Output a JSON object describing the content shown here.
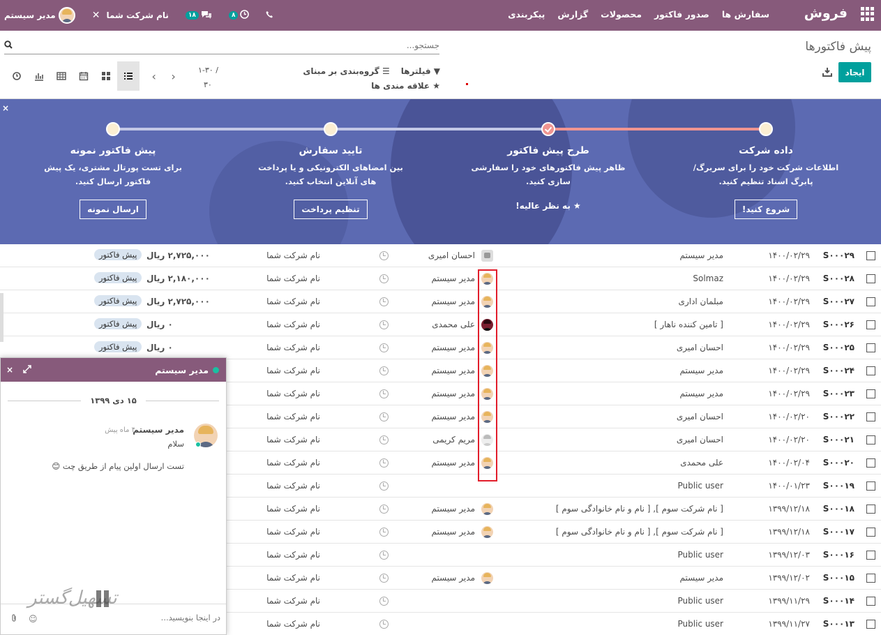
{
  "topbar": {
    "brand": "فروش",
    "menu": [
      "سفارش ها",
      "صدور فاکتور",
      "محصولات",
      "گزارش",
      "پیکربندی"
    ],
    "user_name": "مدیر سیستم",
    "company": "نام شرکت شما",
    "messages_count": "۱۸",
    "activities_count": "۸",
    "color": "#875a7b"
  },
  "control": {
    "breadcrumb": "پیش فاکتورها",
    "search_placeholder": "جستجو...",
    "create_label": "ایجاد",
    "filters_label": "فیلترها",
    "groupby_label": "گروه‌بندی بر مبنای",
    "favorites_label": "علاقه مندی ها",
    "pager_range": "۱-۳۰ /",
    "pager_total": "۳۰"
  },
  "banner": {
    "close": "×",
    "steps": [
      {
        "title": "داده شرکت",
        "desc1": "اطلاعات شرکت خود را برای سربرگ/",
        "desc2": "پابرگ اسناد تنظیم کنید.",
        "button": "شروع کنید!"
      },
      {
        "title": "طرح پیش فاکتور",
        "desc1": "ظاهر پیش فاکتورهای خود را سفارشی",
        "desc2": "سازی کنید.",
        "link": "به نظر عالیه!"
      },
      {
        "title": "تایید سفارش",
        "desc1": "بین امضاهای الکترونیکی و یا پرداخت",
        "desc2": "های آنلاین انتخاب کنید.",
        "button": "تنظیم پرداخت"
      },
      {
        "title": "پیش فاکتور نمونه",
        "desc1": "برای تست پورتال مشتری، یک پیش",
        "desc2": "فاکتور ارسال کنید.",
        "button": "ارسال نمونه"
      }
    ],
    "color": "#5c6ab2"
  },
  "rows": [
    {
      "name": "S۰۰۰۲۹",
      "date": "۱۴۰۰/۰۲/۲۹",
      "customer": "مدیر سیستم",
      "av": "cam",
      "sp": "احسان امیری",
      "company": "نام شرکت شما",
      "amount": "۲,۷۲۵,۰۰۰ ریال",
      "tag": "پیش فاکتور"
    },
    {
      "name": "S۰۰۰۲۸",
      "date": "۱۴۰۰/۰۲/۲۹",
      "customer": "Solmaz",
      "av": "man",
      "sp": "مدیر سیستم",
      "company": "نام شرکت شما",
      "amount": "۲,۱۸۰,۰۰۰ ریال",
      "tag": "پیش فاکتور"
    },
    {
      "name": "S۰۰۰۲۷",
      "date": "۱۴۰۰/۰۲/۲۹",
      "customer": "مبلمان اداری",
      "av": "man",
      "sp": "مدیر سیستم",
      "company": "نام شرکت شما",
      "amount": "۲,۷۲۵,۰۰۰ ریال",
      "tag": "پیش فاکتور"
    },
    {
      "name": "S۰۰۰۲۶",
      "date": "۱۴۰۰/۰۲/۲۹",
      "customer": "[ تامین کننده ناهار ]",
      "av": "dark",
      "sp": "علی محمدی",
      "company": "نام شرکت شما",
      "amount": "۰ ریال",
      "tag": "پیش فاکتور"
    },
    {
      "name": "S۰۰۰۲۵",
      "date": "۱۴۰۰/۰۲/۲۹",
      "customer": "احسان امیری",
      "av": "man",
      "sp": "مدیر سیستم",
      "company": "نام شرکت شما",
      "amount": "۰ ریال",
      "tag": "پیش فاکتور"
    },
    {
      "name": "S۰۰۰۲۴",
      "date": "۱۴۰۰/۰۲/۲۹",
      "customer": "مدیر سیستم",
      "av": "man",
      "sp": "مدیر سیستم",
      "company": "نام شرکت شما",
      "amount": "",
      "tag": ""
    },
    {
      "name": "S۰۰۰۲۳",
      "date": "۱۴۰۰/۰۲/۲۹",
      "customer": "مدیر سیستم",
      "av": "man",
      "sp": "مدیر سیستم",
      "company": "نام شرکت شما",
      "amount": "",
      "tag": ""
    },
    {
      "name": "S۰۰۰۲۲",
      "date": "۱۴۰۰/۰۲/۲۰",
      "customer": "احسان امیری",
      "av": "man",
      "sp": "مدیر سیستم",
      "company": "نام شرکت شما",
      "amount": "",
      "tag": ""
    },
    {
      "name": "S۰۰۰۲۱",
      "date": "۱۴۰۰/۰۲/۲۰",
      "customer": "احسان امیری",
      "av": "woman",
      "sp": "مریم کریمی",
      "company": "نام شرکت شما",
      "amount": "",
      "tag": ""
    },
    {
      "name": "S۰۰۰۲۰",
      "date": "۱۴۰۰/۰۲/۰۴",
      "customer": "علی محمدی",
      "av": "man",
      "sp": "مدیر سیستم",
      "company": "نام شرکت شما",
      "amount": "",
      "tag": ""
    },
    {
      "name": "S۰۰۰۱۹",
      "date": "۱۴۰۰/۰۱/۲۳",
      "customer": "Public user",
      "av": "",
      "sp": "",
      "company": "نام شرکت شما",
      "amount": "",
      "tag": ""
    },
    {
      "name": "S۰۰۰۱۸",
      "date": "۱۳۹۹/۱۲/۱۸",
      "customer": "[ نام شرکت سوم ], [ نام و نام خانوادگی سوم ]",
      "av": "man",
      "sp": "مدیر سیستم",
      "company": "نام شرکت شما",
      "amount": "",
      "tag": ""
    },
    {
      "name": "S۰۰۰۱۷",
      "date": "۱۳۹۹/۱۲/۱۸",
      "customer": "[ نام شرکت سوم ], [ نام و نام خانوادگی سوم ]",
      "av": "man",
      "sp": "مدیر سیستم",
      "company": "نام شرکت شما",
      "amount": "",
      "tag": ""
    },
    {
      "name": "S۰۰۰۱۶",
      "date": "۱۳۹۹/۱۲/۰۳",
      "customer": "Public user",
      "av": "",
      "sp": "",
      "company": "نام شرکت شما",
      "amount": "",
      "tag": ""
    },
    {
      "name": "S۰۰۰۱۵",
      "date": "۱۳۹۹/۱۲/۰۲",
      "customer": "مدیر سیستم",
      "av": "man",
      "sp": "مدیر سیستم",
      "company": "نام شرکت شما",
      "amount": "",
      "tag": ""
    },
    {
      "name": "S۰۰۰۱۴",
      "date": "۱۳۹۹/۱۱/۲۹",
      "customer": "Public user",
      "av": "",
      "sp": "",
      "company": "نام شرکت شما",
      "amount": "",
      "tag": ""
    },
    {
      "name": "S۰۰۰۱۳",
      "date": "۱۳۹۹/۱۱/۲۷",
      "customer": "Public user",
      "av": "",
      "sp": "",
      "company": "نام شرکت شما",
      "amount": "",
      "tag": ""
    }
  ],
  "chat": {
    "title": "مدیر سیستم",
    "date": "۱۵ دی ۱۳۹۹",
    "author": "مدیر سیستم",
    "time": "۴ ماه پیش",
    "line1": "سلام",
    "line2": "تست ارسال اولین پیام از طریق چت 😊",
    "placeholder": "در اینجا بنویسید...",
    "close": "×"
  },
  "watermark": "تسهیل‌گستر"
}
